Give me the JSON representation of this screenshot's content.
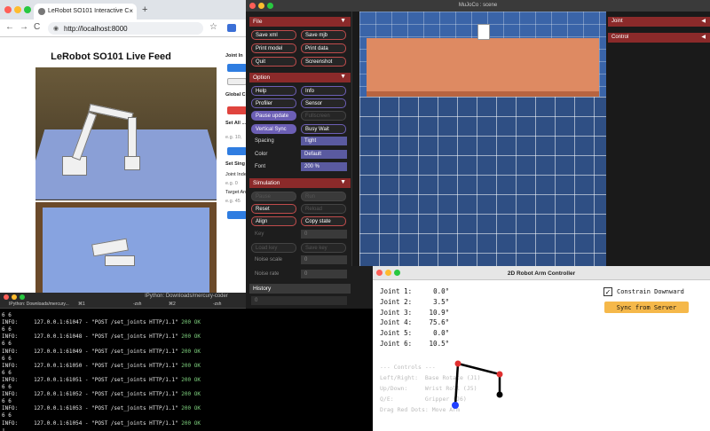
{
  "browser": {
    "tab_title": "LeRobot SO101 Interactive C",
    "tab_close": "×",
    "new_tab": "+",
    "back": "←",
    "forward": "→",
    "reload": "C",
    "url": "http://localhost:8000",
    "star": "☆",
    "page_title": "LeRobot SO101 Live Feed",
    "right_panel": {
      "joint_label": "Joint In",
      "global_label": "Global C",
      "set_all_label": "Set All ...",
      "set_single_label": "Set Sing",
      "joint_index_label": "Joint Inde",
      "target_label": "Target An",
      "placeholder1": "e.g. 10,",
      "placeholder2": "e.g. 0",
      "placeholder3": "e.g. 45"
    }
  },
  "terminal": {
    "window_title": "IPython: Downloads/mercury-coder",
    "tabs": [
      "IPython: Downloads/mercury...",
      "⌘1",
      "-zsh",
      "⌘2",
      "-zsh",
      "⌘3"
    ],
    "lines": [
      {
        "text": "6 6",
        "ok": ""
      },
      {
        "text": "INFO:     127.0.0.1:61047 - \"POST /set_joints HTTP/1.1\" ",
        "ok": "200 OK"
      },
      {
        "text": "6 6",
        "ok": ""
      },
      {
        "text": "INFO:     127.0.0.1:61048 - \"POST /set_joints HTTP/1.1\" ",
        "ok": "200 OK"
      },
      {
        "text": "6 6",
        "ok": ""
      },
      {
        "text": "INFO:     127.0.0.1:61049 - \"POST /set_joints HTTP/1.1\" ",
        "ok": "200 OK"
      },
      {
        "text": "6 6",
        "ok": ""
      },
      {
        "text": "INFO:     127.0.0.1:61050 - \"POST /set_joints HTTP/1.1\" ",
        "ok": "200 OK"
      },
      {
        "text": "6 6",
        "ok": ""
      },
      {
        "text": "INFO:     127.0.0.1:61051 - \"POST /set_joints HTTP/1.1\" ",
        "ok": "200 OK"
      },
      {
        "text": "6 6",
        "ok": ""
      },
      {
        "text": "INFO:     127.0.0.1:61052 - \"POST /set_joints HTTP/1.1\" ",
        "ok": "200 OK"
      },
      {
        "text": "6 6",
        "ok": ""
      },
      {
        "text": "INFO:     127.0.0.1:61053 - \"POST /set_joints HTTP/1.1\" ",
        "ok": "200 OK"
      },
      {
        "text": "6 6",
        "ok": ""
      },
      {
        "text": "INFO:     127.0.0.1:61054 - \"POST /set_joints HTTP/1.1\" ",
        "ok": "200 OK"
      },
      {
        "text": "▯",
        "ok": ""
      }
    ]
  },
  "mujoco": {
    "window_title": "MuJoCo : scene",
    "file": {
      "header": "File",
      "buttons": [
        "Save xml",
        "Save mjb",
        "Print model",
        "Print data",
        "Quit",
        "Screenshot"
      ]
    },
    "option": {
      "header": "Option",
      "buttons": [
        "Help",
        "Info",
        "Profiler",
        "Sensor",
        "Pause update",
        "Fullscreen",
        "Vertical Sync",
        "Busy Wait"
      ],
      "spacing_label": "Spacing",
      "spacing_value": "Tight",
      "color_label": "Color",
      "color_value": "Default",
      "font_label": "Font",
      "font_value": "200 %"
    },
    "simulation": {
      "header": "Simulation",
      "buttons": [
        "Pause",
        "Run",
        "Reset",
        "Reload",
        "Align",
        "Copy state",
        "Key",
        "0",
        "Load key",
        "Save key"
      ],
      "noise_scale_label": "Noise scale",
      "noise_scale_value": "0",
      "noise_rate_label": "Noise rate",
      "noise_rate_value": "0"
    },
    "history": {
      "header": "History",
      "value": "0"
    },
    "right": {
      "joint": "Joint",
      "control": "Control"
    },
    "collapse_icon": "▼",
    "expand_icon": "◀"
  },
  "arm_controller": {
    "title": "2D Robot Arm Controller",
    "joints": [
      {
        "label": "Joint 1:",
        "value": "0.0°"
      },
      {
        "label": "Joint 2:",
        "value": "3.5°"
      },
      {
        "label": "Joint 3:",
        "value": "10.9°"
      },
      {
        "label": "Joint 4:",
        "value": "75.6°"
      },
      {
        "label": "Joint 5:",
        "value": "0.0°"
      },
      {
        "label": "Joint 6:",
        "value": "10.5°"
      }
    ],
    "constrain_label": "Constrain Downward",
    "constrain_checked": "✓",
    "sync_button": "Sync from Server",
    "controls": [
      "--- Controls ---",
      "Left/Right:  Base Rotate (J1)",
      "Up/Down:     Wrist Roll (J5)",
      "Q/E:         Gripper (J6)",
      "Drag Red Dots: Move Arm"
    ]
  }
}
